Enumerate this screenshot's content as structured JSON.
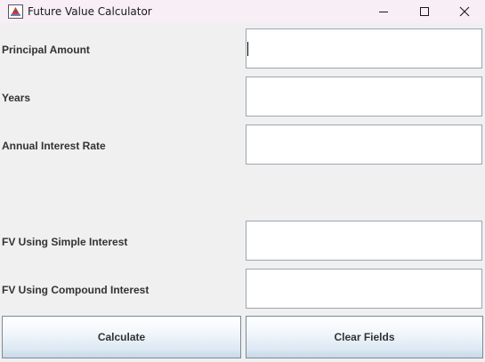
{
  "window": {
    "title": "Future Value Calculator"
  },
  "form": {
    "principal": {
      "label": "Principal Amount",
      "value": ""
    },
    "years": {
      "label": "Years",
      "value": ""
    },
    "rate": {
      "label": "Annual Interest Rate",
      "value": ""
    },
    "fv_simple": {
      "label": "FV Using Simple Interest",
      "value": ""
    },
    "fv_compound": {
      "label": "FV Using Compound Interest",
      "value": ""
    }
  },
  "buttons": {
    "calculate": "Calculate",
    "clear": "Clear Fields"
  },
  "icons": {
    "app": "java-cup-icon",
    "minimize": "minimize-icon",
    "maximize": "maximize-icon",
    "close": "close-icon"
  },
  "colors": {
    "titlebar": "#f7eef6",
    "window_bg": "#f0f0f0",
    "field_border": "#9aa6b3",
    "button_gradient_bottom": "#c9d9e8"
  }
}
